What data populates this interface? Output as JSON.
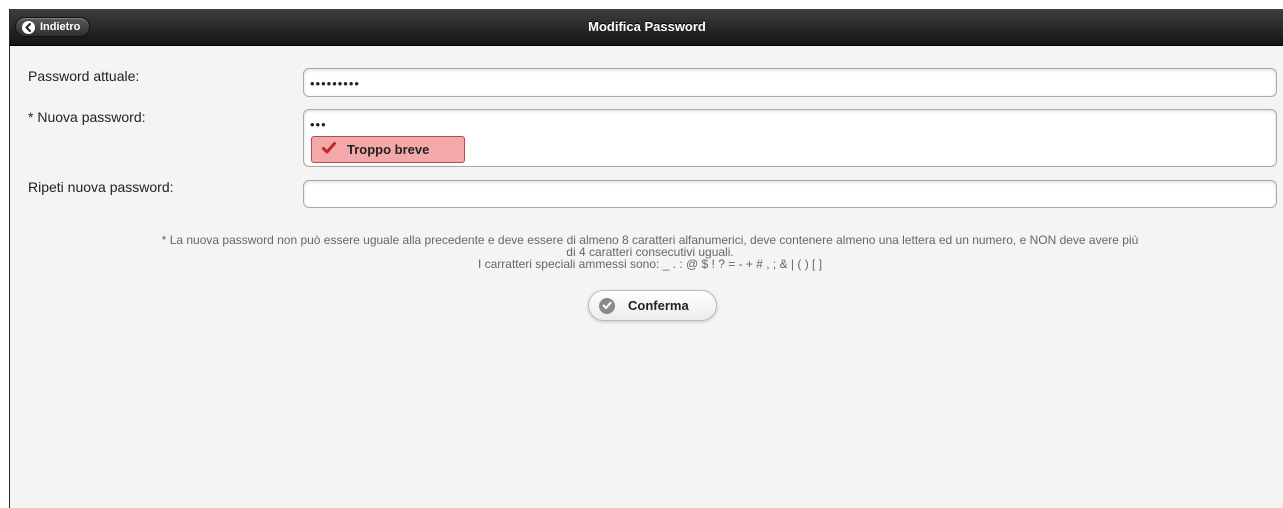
{
  "header": {
    "back_label": "Indietro",
    "title": "Modifica Password"
  },
  "form": {
    "current_password": {
      "label": "Password attuale:",
      "value": "•••••••••"
    },
    "new_password": {
      "label": "* Nuova password:",
      "value": "•••",
      "validation": {
        "message": "Troppo breve",
        "icon": "red-check-icon",
        "color": "#f3a9a9"
      }
    },
    "repeat_password": {
      "label": "Ripeti nuova password:",
      "value": ""
    }
  },
  "note": {
    "line1": "* La nuova password non può essere uguale alla precedente e deve essere di almeno 8 caratteri alfanumerici, deve contenere almeno una lettera ed un numero, e NON deve avere più",
    "line2": "di 4 caratteri consecutivi uguali.",
    "line3": "I carratteri speciali ammessi sono: _ . : @ $ ! ? = - + # , ; & | ( ) [ ]"
  },
  "actions": {
    "confirm_label": "Conferma",
    "confirm_icon": "check-circle-icon"
  },
  "colors": {
    "header_bg": "#1e1e1e",
    "page_bg": "#f4f4f4",
    "error_bg": "#f3a9a9",
    "error_check": "#c0272d"
  }
}
